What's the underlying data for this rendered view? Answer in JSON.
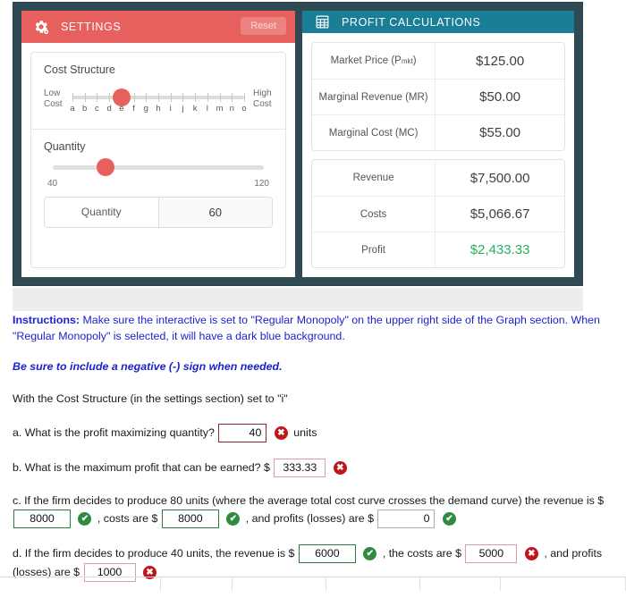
{
  "widget": {
    "settings_panel": {
      "header_title": "SETTINGS",
      "header_icon": "gear-icon",
      "reset_label": "Reset",
      "cost_structure": {
        "label": "Cost Structure",
        "low_line1": "Low",
        "low_line2": "Cost",
        "high_line1": "High",
        "high_line2": "Cost",
        "letters": [
          "a",
          "b",
          "c",
          "d",
          "e",
          "f",
          "g",
          "h",
          "i",
          "j",
          "k",
          "l",
          "m",
          "n",
          "o"
        ],
        "selected_letter": "e",
        "selected_index": 4
      },
      "quantity": {
        "label": "Quantity",
        "min": "40",
        "max": "120",
        "addon_label": "Quantity",
        "value": "60",
        "thumb_percent": 25
      }
    },
    "profit_panel": {
      "header_title": "PROFIT CALCULATIONS",
      "header_icon": "calculator-icon",
      "table_top": [
        {
          "label_main": "Market Price (P",
          "label_sub": "mkt",
          "label_tail": ")",
          "value": "$125.00"
        },
        {
          "label_main": "Marginal Revenue (MR)",
          "label_sub": "",
          "label_tail": "",
          "value": "$50.00"
        },
        {
          "label_main": "Marginal Cost (MC)",
          "label_sub": "",
          "label_tail": "",
          "value": "$55.00"
        }
      ],
      "table_bottom": [
        {
          "label": "Revenue",
          "value": "$7,500.00",
          "positive": false
        },
        {
          "label": "Costs",
          "value": "$5,066.67",
          "positive": false
        },
        {
          "label": "Profit",
          "value": "$2,433.33",
          "positive": true
        }
      ]
    }
  },
  "question": {
    "instructions_bold": "Instructions:",
    "instructions_text": " Make sure the interactive is set to \"Regular Monopoly\" on the upper right side of the Graph section. When \"Regular Monopoly\" is selected, it will have a dark blue background.",
    "note": "Be sure to include a negative (-) sign when needed.",
    "setup_line": "With the Cost Structure (in the settings section) set to \"i\"",
    "part_a": {
      "prompt": "a. What is the profit maximizing quantity?",
      "value": "40",
      "status": "wrong",
      "suffix": "units"
    },
    "part_b": {
      "prompt": "b. What is the maximum profit that can be earned? $",
      "value": "333.33",
      "status": "wrong"
    },
    "part_c": {
      "text_1": "c. If the firm decides to produce 80 units (where the average total cost curve crosses the demand curve) the revenue is $",
      "revenue_value": "8000",
      "revenue_status": "right",
      "text_2": ", costs are $",
      "costs_value": "8000",
      "costs_status": "right",
      "text_3": ", and profits (losses) are $",
      "profit_value": "0",
      "profit_status": "right"
    },
    "part_d": {
      "text_1": "d. If the firm decides to produce 40 units, the revenue is $",
      "revenue_value": "6000",
      "revenue_status": "right",
      "text_2": ", the costs are $",
      "costs_value": "5000",
      "costs_status": "wrong",
      "text_3": ", and",
      "text_4": "profits (losses) are $",
      "profit_value": "1000",
      "profit_status": "wrong"
    },
    "mark_wrong_glyph": "✖",
    "mark_right_glyph": "✔"
  },
  "colors": {
    "settings_header": "#e8605d",
    "profit_header": "#1a7f96",
    "frame": "#2f4a52",
    "positive_value": "#27ae60",
    "instruction_blue": "#1d22cc",
    "wrong_mark": "#c0151b",
    "right_mark": "#2f8b3f"
  }
}
